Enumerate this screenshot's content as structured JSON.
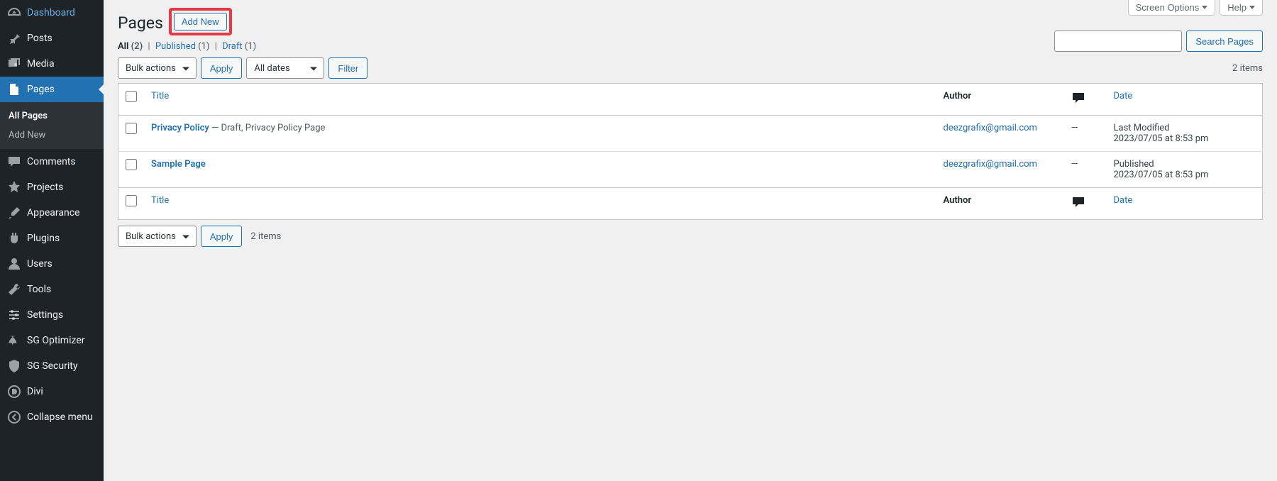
{
  "top_buttons": {
    "screen_options": "Screen Options",
    "help": "Help"
  },
  "sidebar": {
    "items": [
      {
        "icon": "dashboard",
        "label": "Dashboard"
      },
      {
        "icon": "pin",
        "label": "Posts"
      },
      {
        "icon": "media",
        "label": "Media"
      },
      {
        "icon": "page",
        "label": "Pages",
        "current": true
      },
      {
        "icon": "comment",
        "label": "Comments"
      },
      {
        "icon": "star",
        "label": "Projects"
      },
      {
        "icon": "brush",
        "label": "Appearance"
      },
      {
        "icon": "plug",
        "label": "Plugins"
      },
      {
        "icon": "user",
        "label": "Users"
      },
      {
        "icon": "wrench",
        "label": "Tools"
      },
      {
        "icon": "sliders",
        "label": "Settings"
      },
      {
        "icon": "rocket",
        "label": "SG Optimizer"
      },
      {
        "icon": "shield",
        "label": "SG Security"
      },
      {
        "icon": "divi",
        "label": "Divi"
      },
      {
        "icon": "collapse",
        "label": "Collapse menu"
      }
    ],
    "submenu": [
      {
        "label": "All Pages",
        "current": true
      },
      {
        "label": "Add New"
      }
    ]
  },
  "heading": {
    "title": "Pages",
    "add_new": "Add New"
  },
  "filters": {
    "all_label": "All",
    "all_count": "(2)",
    "published_label": "Published",
    "published_count": "(1)",
    "draft_label": "Draft",
    "draft_count": "(1)"
  },
  "tablenav": {
    "bulk_actions": "Bulk actions",
    "apply": "Apply",
    "all_dates": "All dates",
    "filter": "Filter",
    "items_count": "2 items"
  },
  "search": {
    "placeholder": "",
    "value": "",
    "button": "Search Pages"
  },
  "columns": {
    "title": "Title",
    "author": "Author",
    "date": "Date"
  },
  "rows": [
    {
      "title": "Privacy Policy",
      "state": " — Draft, Privacy Policy Page",
      "author": "deezgrafix@gmail.com",
      "comments": "—",
      "date_status": "Last Modified",
      "date_value": "2023/07/05 at 8:53 pm"
    },
    {
      "title": "Sample Page",
      "state": "",
      "author": "deezgrafix@gmail.com",
      "comments": "—",
      "date_status": "Published",
      "date_value": "2023/07/05 at 8:53 pm"
    }
  ]
}
